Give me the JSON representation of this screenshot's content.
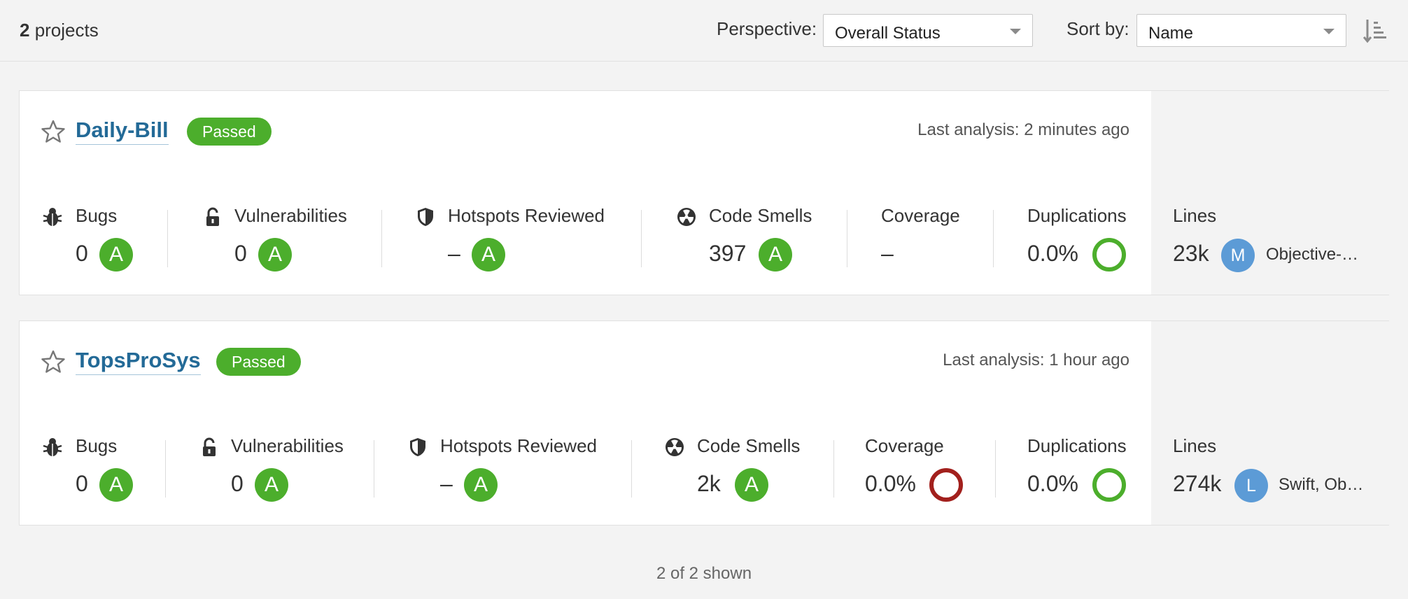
{
  "header": {
    "project_count": "2",
    "project_count_suffix": " projects",
    "perspective_label": "Perspective:",
    "perspective_value": "Overall Status",
    "sort_label": "Sort by:",
    "sort_value": "Name"
  },
  "labels": {
    "bugs": "Bugs",
    "vulnerabilities": "Vulnerabilities",
    "hotspots": "Hotspots Reviewed",
    "code_smells": "Code Smells",
    "coverage": "Coverage",
    "duplications": "Duplications",
    "lines": "Lines"
  },
  "projects": [
    {
      "name": "Daily-Bill",
      "status": "Passed",
      "last_analysis": "Last analysis: 2 minutes ago",
      "bugs": "0",
      "bugs_rating": "A",
      "vulnerabilities": "0",
      "vulnerabilities_rating": "A",
      "hotspots": "–",
      "hotspots_rating": "A",
      "code_smells": "397",
      "code_smells_rating": "A",
      "coverage": "–",
      "duplications": "0.0%",
      "lines": "23k",
      "lang_avatar": "M",
      "languages": "Objective-…"
    },
    {
      "name": "TopsProSys",
      "status": "Passed",
      "last_analysis": "Last analysis: 1 hour ago",
      "bugs": "0",
      "bugs_rating": "A",
      "vulnerabilities": "0",
      "vulnerabilities_rating": "A",
      "hotspots": "–",
      "hotspots_rating": "A",
      "code_smells": "2k",
      "code_smells_rating": "A",
      "coverage": "0.0%",
      "duplications": "0.0%",
      "lines": "274k",
      "lang_avatar": "L",
      "languages": "Swift, Ob…"
    }
  ],
  "footer": {
    "shown": "2 of 2 shown"
  },
  "colors": {
    "rating_a": "#4cae2c",
    "passed": "#4cae2c",
    "coverage_bad": "#a2201d",
    "link": "#236a97",
    "avatar": "#5c9bd6"
  }
}
